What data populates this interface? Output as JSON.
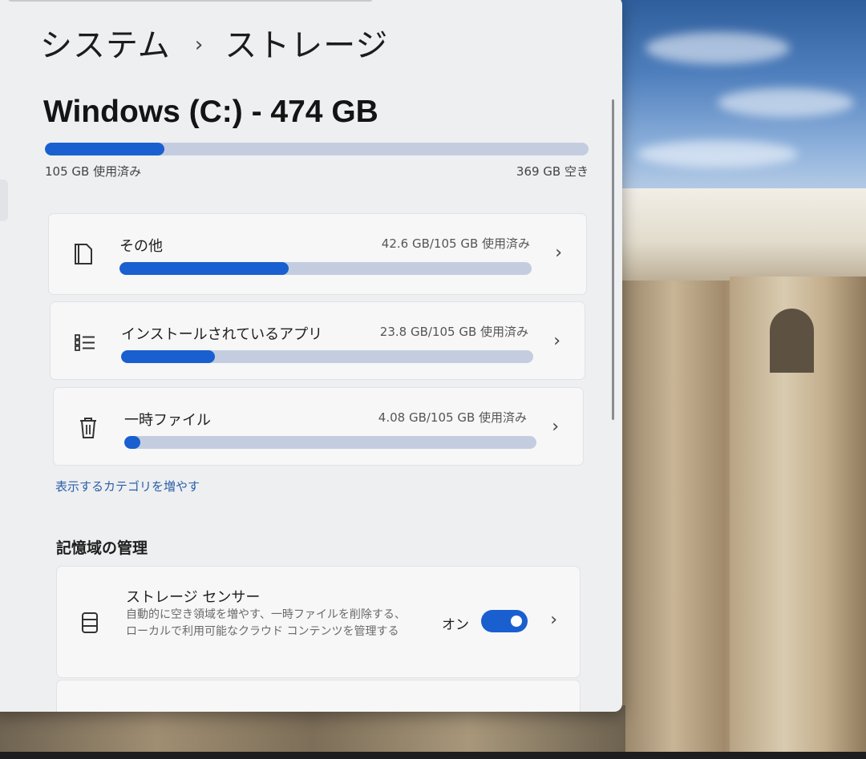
{
  "breadcrumb": {
    "parent": "システム",
    "separator": "›",
    "current": "ストレージ"
  },
  "drive": {
    "title": "Windows (C:) - 474 GB",
    "used_fraction": 0.22,
    "used_label": "105 GB 使用済み",
    "free_label": "369 GB 空き"
  },
  "categories": [
    {
      "name": "その他",
      "amount": "42.6 GB/105 GB 使用済み",
      "fraction": 0.41,
      "icon": "document-icon"
    },
    {
      "name": "インストールされているアプリ",
      "amount": "23.8 GB/105 GB 使用済み",
      "fraction": 0.227,
      "icon": "apps-list-icon"
    },
    {
      "name": "一時ファイル",
      "amount": "4.08 GB/105 GB 使用済み",
      "fraction": 0.039,
      "icon": "trash-icon"
    }
  ],
  "more_categories_link": "表示するカテゴリを増やす",
  "management": {
    "heading": "記憶域の管理",
    "storage_sense": {
      "name": "ストレージ センサー",
      "description": "自動的に空き領域を増やす、一時ファイルを削除する、ローカルで利用可能なクラウド コンテンツを管理する",
      "state_label": "オン",
      "enabled": true,
      "icon": "storage-sense-icon"
    }
  },
  "colors": {
    "accent": "#1a5fcf",
    "track": "#c4cde0",
    "link": "#2a5fa8"
  }
}
